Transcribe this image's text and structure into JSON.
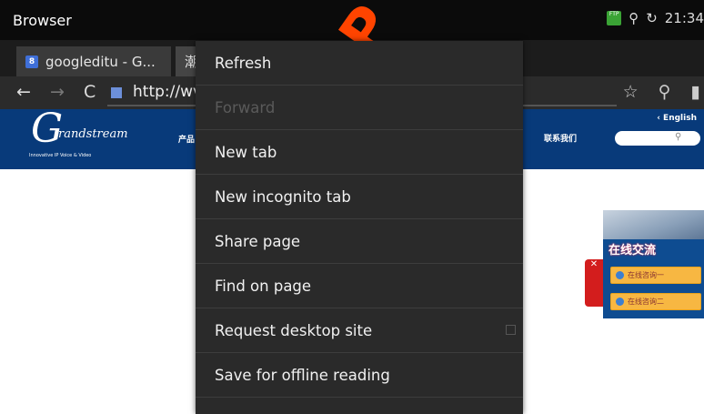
{
  "statusbar": {
    "title": "Browser",
    "ftp_label": "FTP",
    "time": "21:34"
  },
  "tabs": [
    {
      "favicon": "8",
      "label": "googleditu - G..."
    },
    {
      "label": "潮"
    }
  ],
  "urlbar": {
    "url": "http://wv"
  },
  "site": {
    "logo_g": "G",
    "logo_brand": "randstream",
    "logo_tagline": "Innovative IP Voice & Video",
    "nav_left": "产品",
    "nav_contact": "联系我们",
    "english_link": "‹ English",
    "chat_title": "在线交流",
    "chat_btn1": "在线咨询一",
    "chat_btn2": "在线咨询二"
  },
  "watermark": "x-P",
  "menu": {
    "items": [
      {
        "label": "Refresh",
        "enabled": true
      },
      {
        "label": "Forward",
        "enabled": false
      },
      {
        "label": "New tab",
        "enabled": true
      },
      {
        "label": "New incognito tab",
        "enabled": true
      },
      {
        "label": "Share page",
        "enabled": true
      },
      {
        "label": "Find on page",
        "enabled": true
      },
      {
        "label": "Request desktop site",
        "enabled": true,
        "checkbox": false
      },
      {
        "label": "Save for offline reading",
        "enabled": true
      }
    ]
  },
  "colors": {
    "site_header": "#083a7a",
    "menu_bg": "#2a2a2a",
    "watermark": "#ff4400"
  }
}
